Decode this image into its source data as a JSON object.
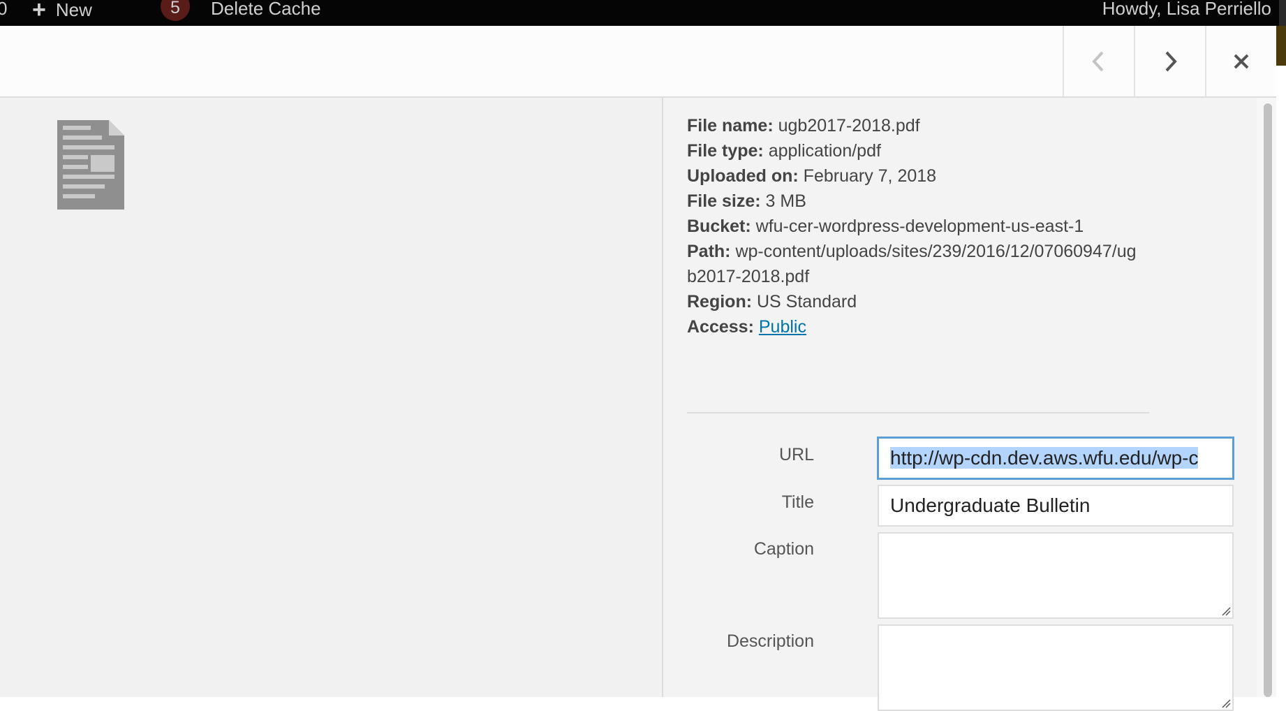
{
  "adminbar": {
    "partial_count": "0",
    "new_label": "New",
    "updates_count": "5",
    "delete_cache_label": "Delete Cache",
    "greeting": "Howdy, Lisa Perriello"
  },
  "header": {
    "prev_icon": "chevron-left-icon",
    "next_icon": "chevron-right-icon",
    "close_icon": "close-icon"
  },
  "preview": {
    "icon": "document-icon"
  },
  "details": {
    "file_name_label": "File name:",
    "file_name": "ugb2017-2018.pdf",
    "file_type_label": "File type:",
    "file_type": "application/pdf",
    "uploaded_label": "Uploaded on:",
    "uploaded_on": "February 7, 2018",
    "file_size_label": "File size:",
    "file_size": "3 MB",
    "bucket_label": "Bucket:",
    "bucket": "wfu-cer-wordpress-development-us-east-1",
    "path_label": "Path:",
    "path": "wp-content/uploads/sites/239/2016/12/07060947/ugb2017-2018.pdf",
    "region_label": "Region:",
    "region": "US Standard",
    "access_label": "Access:",
    "access": "Public"
  },
  "form": {
    "url_label": "URL",
    "url_value": "http://wp-cdn.dev.aws.wfu.edu/wp-c",
    "title_label": "Title",
    "title_value": "Undergraduate Bulletin",
    "caption_label": "Caption",
    "caption_value": "",
    "description_label": "Description",
    "description_value": ""
  },
  "colors": {
    "adminbar_bg": "#050505",
    "link": "#0073aa",
    "focus_border": "#5b9dd9",
    "selection": "#b3d4fc"
  }
}
